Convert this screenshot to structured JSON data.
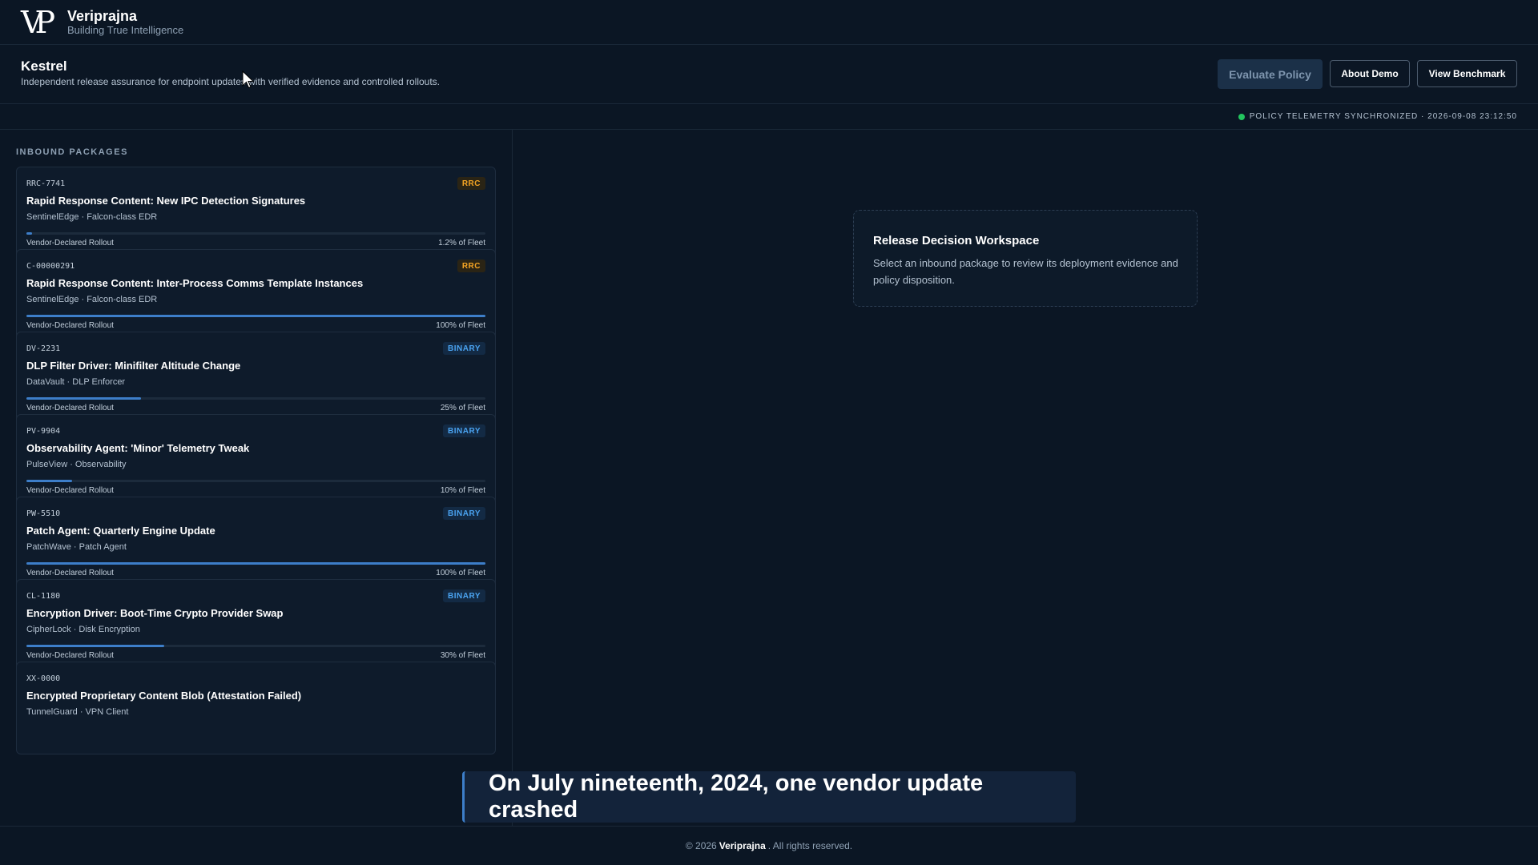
{
  "brand": {
    "logo_text": "VP",
    "name": "Veriprajna",
    "tagline": "Building True Intelligence"
  },
  "product": {
    "title": "Kestrel",
    "subtitle": "Independent release assurance for endpoint updates with verified evidence and controlled rollouts.",
    "buttons": {
      "evaluate": "Evaluate Policy",
      "about": "About Demo",
      "benchmark": "View Benchmark"
    }
  },
  "status": {
    "text": "POLICY TELEMETRY SYNCHRONIZED · 2026-09-08 23:12:50",
    "color": "#22c55e"
  },
  "packages": {
    "label": "INBOUND PACKAGES",
    "items": [
      {
        "id": "RRC-7741",
        "badge": "RRC",
        "title": "Rapid Response Content: New IPC Detection Signatures",
        "vendor": "SentinelEdge · Falcon-class EDR",
        "rollout_label": "Vendor-Declared Rollout",
        "pct_label": "1.2% of Fleet",
        "progress": 0.012
      },
      {
        "id": "C-00000291",
        "badge": "RRC",
        "title": "Rapid Response Content: Inter-Process Comms Template Instances",
        "vendor": "SentinelEdge · Falcon-class EDR",
        "rollout_label": "Vendor-Declared Rollout",
        "pct_label": "100% of Fleet",
        "progress": 1.0
      },
      {
        "id": "DV-2231",
        "badge": "BINARY",
        "title": "DLP Filter Driver: Minifilter Altitude Change",
        "vendor": "DataVault · DLP Enforcer",
        "rollout_label": "Vendor-Declared Rollout",
        "pct_label": "25% of Fleet",
        "progress": 0.25
      },
      {
        "id": "PV-9904",
        "badge": "BINARY",
        "title": "Observability Agent: 'Minor' Telemetry Tweak",
        "vendor": "PulseView · Observability",
        "rollout_label": "Vendor-Declared Rollout",
        "pct_label": "10% of Fleet",
        "progress": 0.1
      },
      {
        "id": "PW-5510",
        "badge": "BINARY",
        "title": "Patch Agent: Quarterly Engine Update",
        "vendor": "PatchWave · Patch Agent",
        "rollout_label": "Vendor-Declared Rollout",
        "pct_label": "100% of Fleet",
        "progress": 1.0
      },
      {
        "id": "CL-1180",
        "badge": "BINARY",
        "title": "Encryption Driver: Boot-Time Crypto Provider Swap",
        "vendor": "CipherLock · Disk Encryption",
        "rollout_label": "Vendor-Declared Rollout",
        "pct_label": "30% of Fleet",
        "progress": 0.3
      },
      {
        "id": "XX-0000",
        "badge": "",
        "title": "Encrypted Proprietary Content Blob (Attestation Failed)",
        "vendor": "TunnelGuard · VPN Client",
        "rollout_label": "",
        "pct_label": "",
        "progress": 0
      }
    ]
  },
  "workspace": {
    "title": "Release Decision Workspace",
    "text": "Select an inbound package to review its deployment evidence and policy disposition."
  },
  "caption": "On July nineteenth, 2024, one vendor update crashed",
  "footer": {
    "prefix": "© 2026",
    "brand": "Veriprajna",
    "suffix": ". All rights reserved."
  }
}
